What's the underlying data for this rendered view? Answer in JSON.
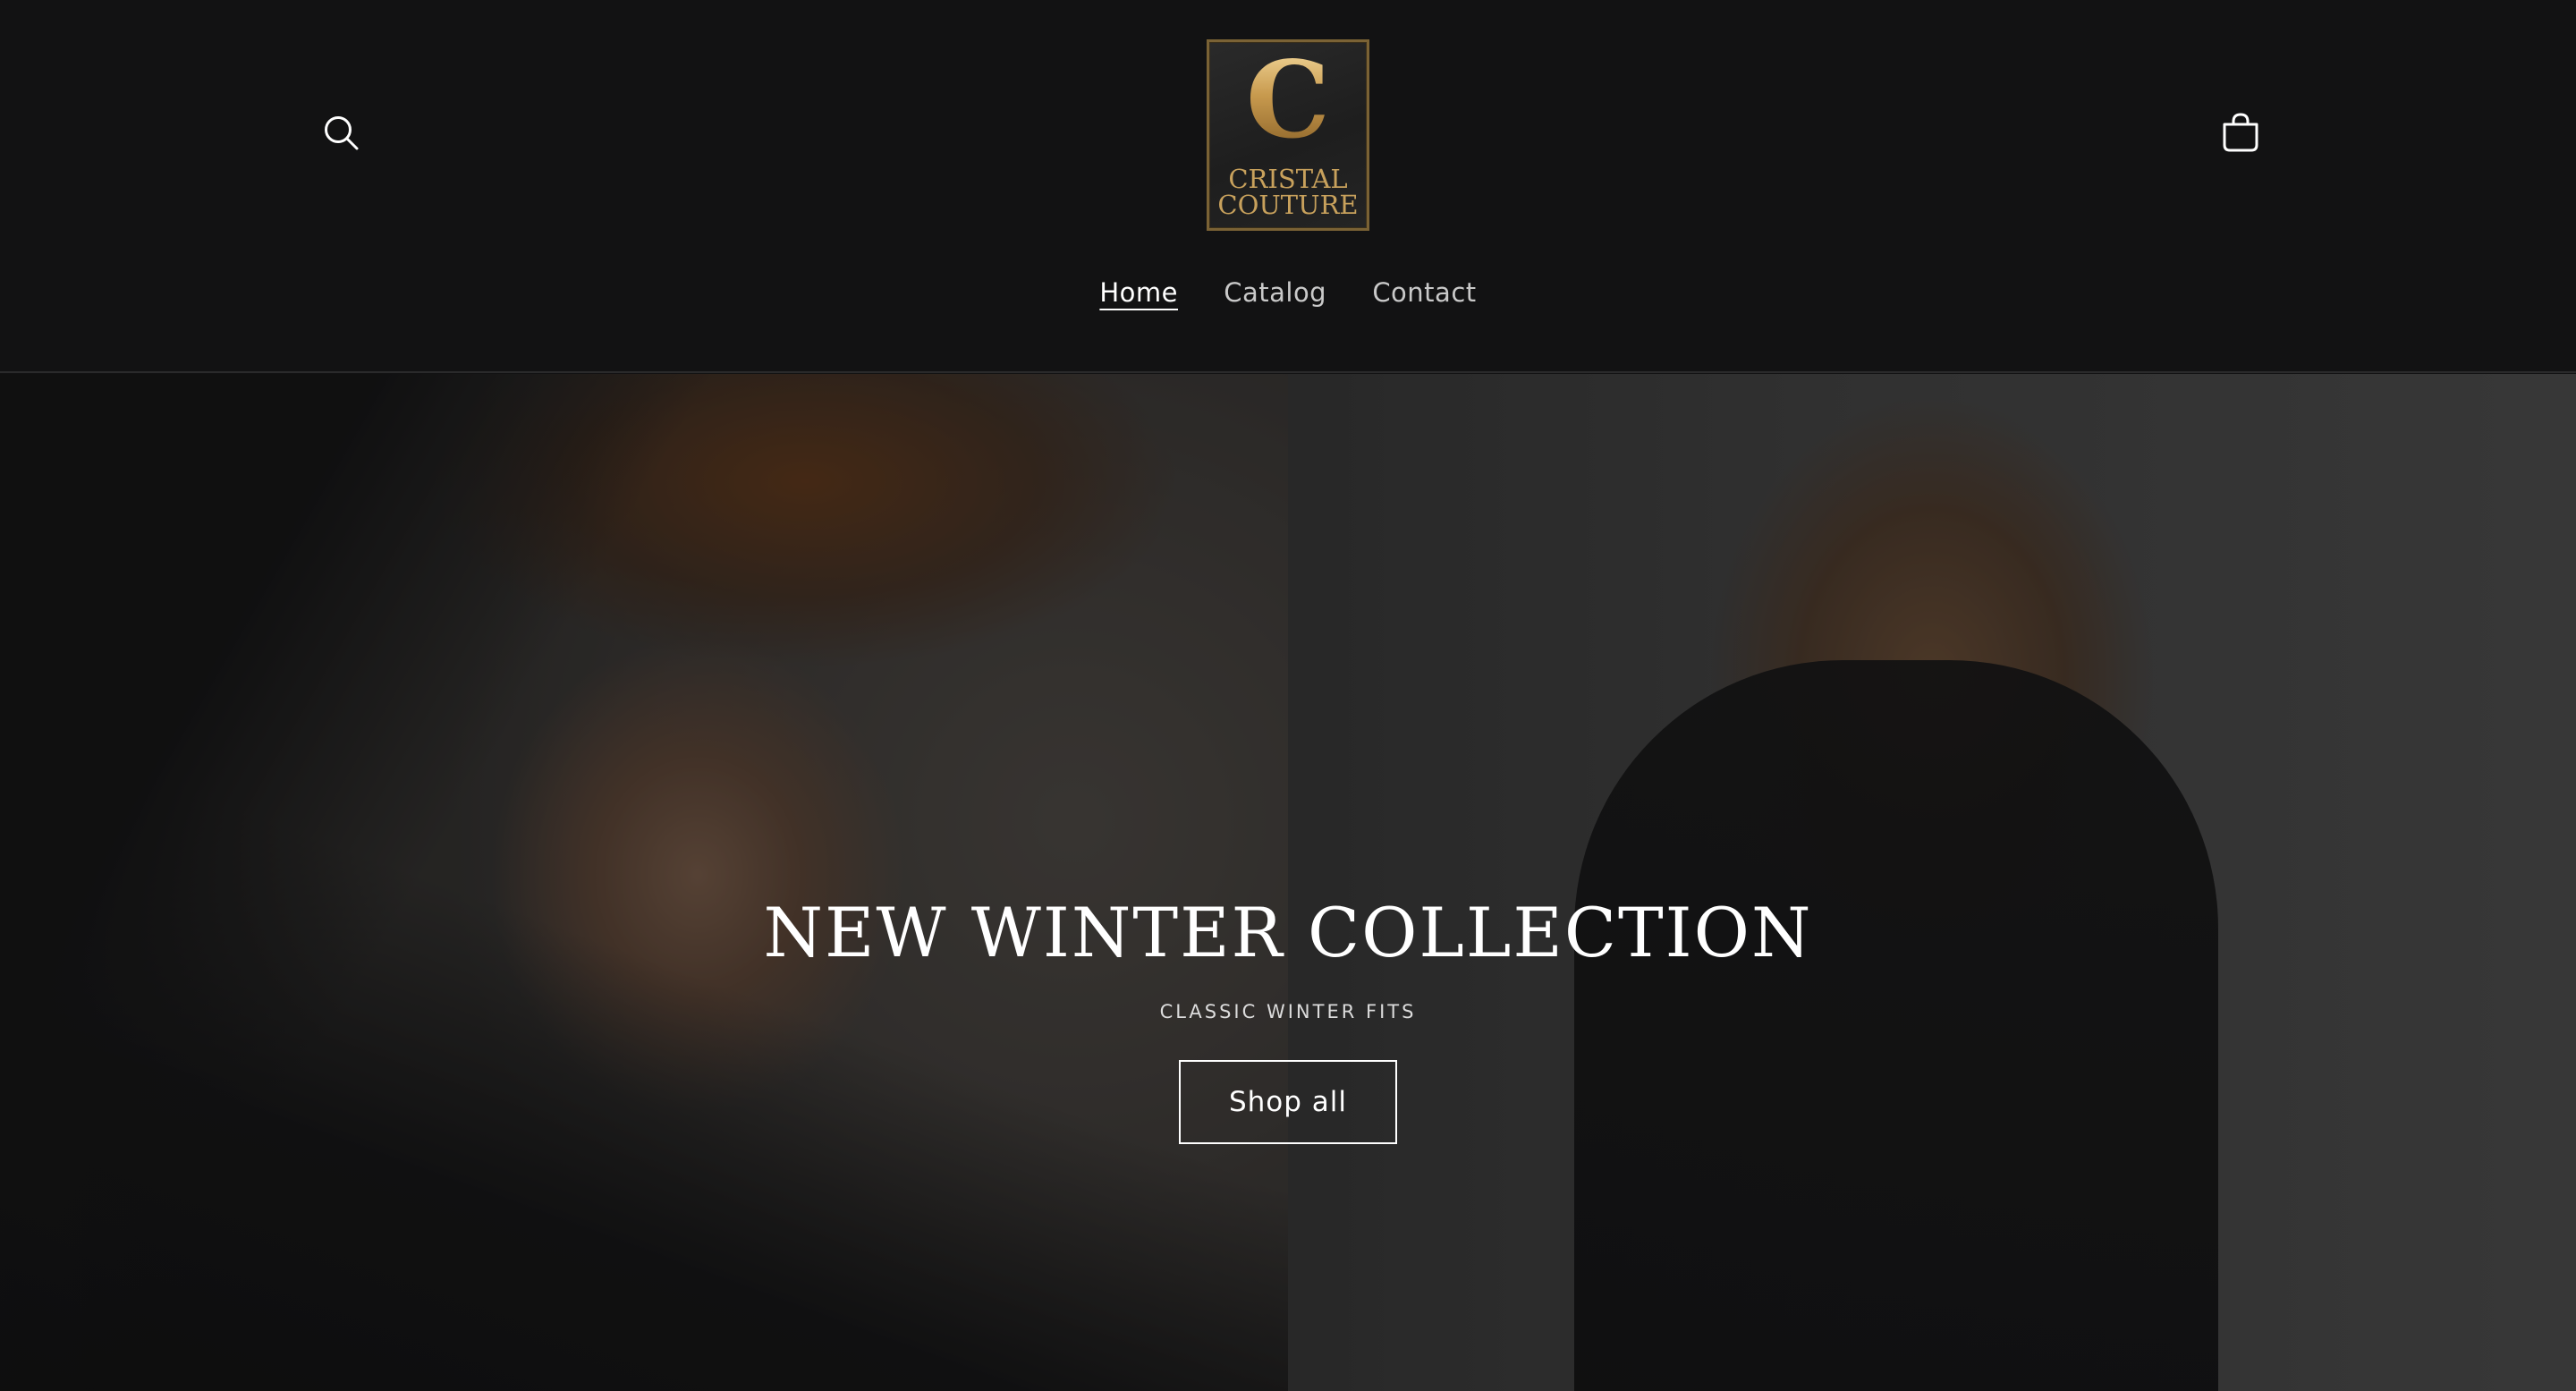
{
  "header": {
    "search_icon": "search-icon",
    "cart_icon": "cart-icon",
    "logo": {
      "letter": "C",
      "line1": "CRISTAL",
      "line2": "COUTURE"
    },
    "nav": [
      {
        "label": "Home",
        "active": true
      },
      {
        "label": "Catalog",
        "active": false
      },
      {
        "label": "Contact",
        "active": false
      }
    ]
  },
  "hero": {
    "title": "NEW WINTER COLLECTION",
    "subtitle": "CLASSIC WINTER FITS",
    "button_label": "Shop all"
  },
  "colors": {
    "background": "#121213",
    "logo_gold": "#c8a15c",
    "text": "#ffffff"
  }
}
